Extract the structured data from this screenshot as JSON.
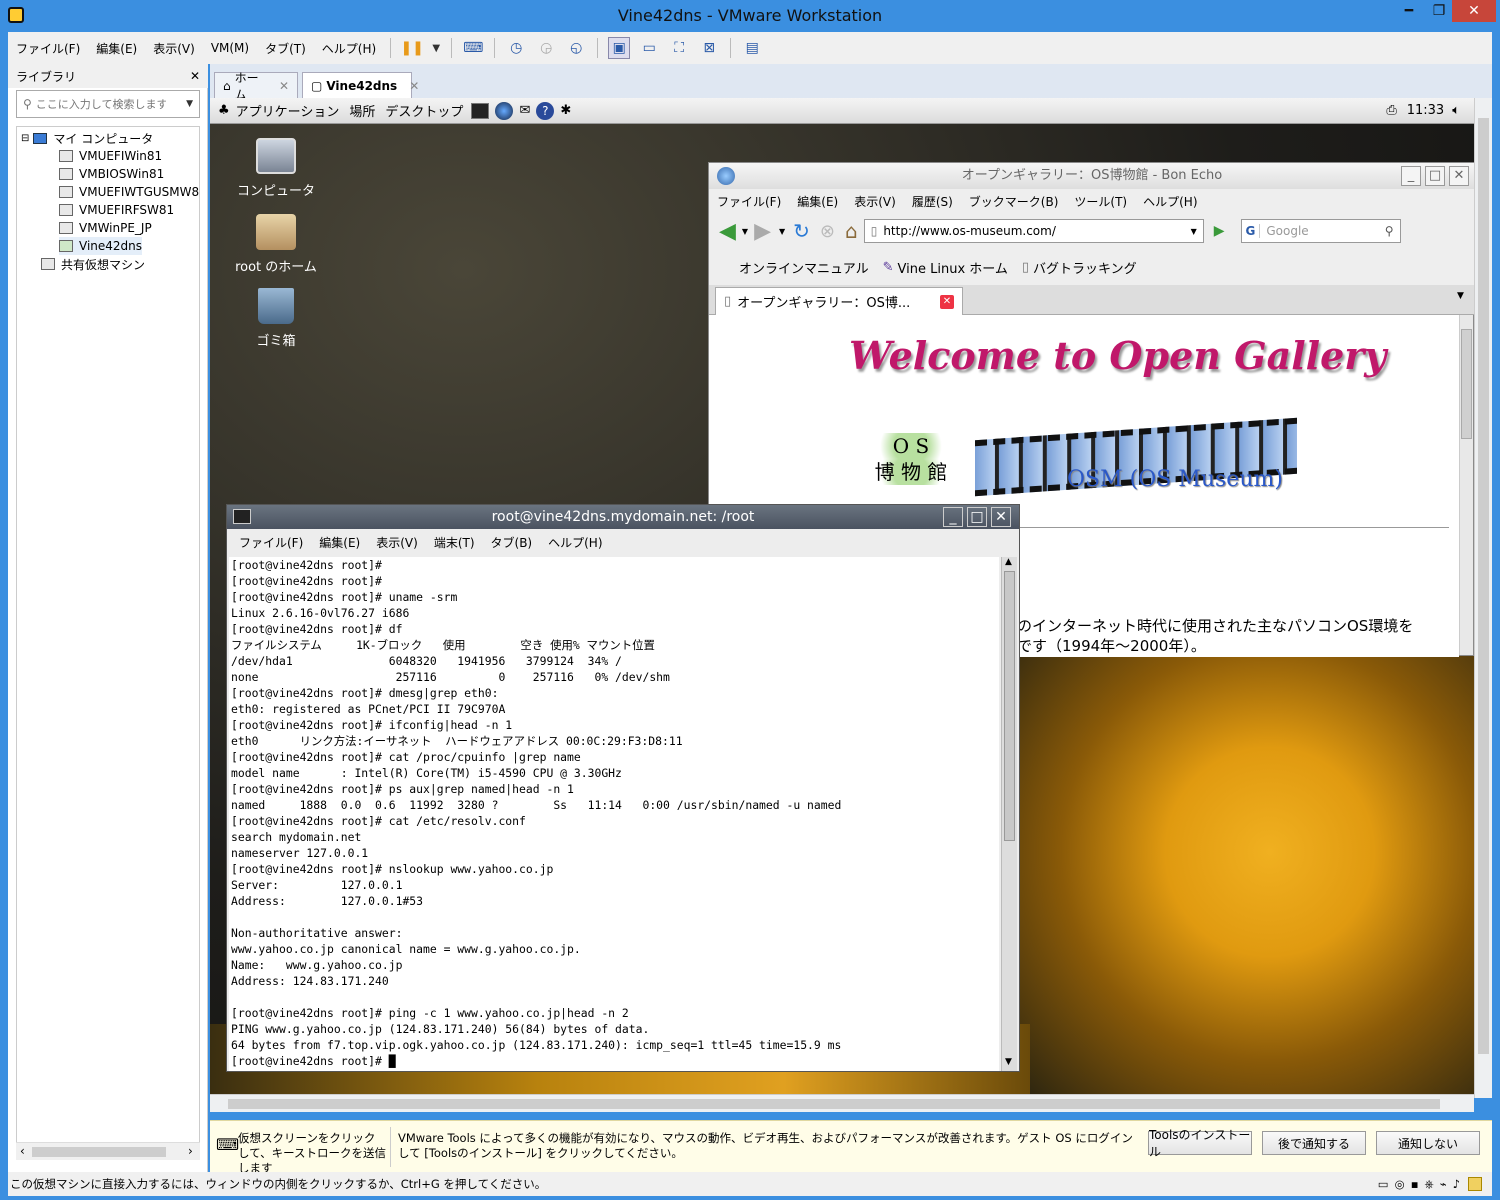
{
  "window": {
    "title": "Vine42dns - VMware Workstation"
  },
  "menubar": {
    "items": [
      "ファイル(F)",
      "編集(E)",
      "表示(V)",
      "VM(M)",
      "タブ(T)",
      "ヘルプ(H)"
    ]
  },
  "library": {
    "title": "ライブラリ",
    "search_placeholder": "ここに入力して検索します",
    "root": "マイ コンピュータ",
    "vms": [
      "VMUEFIWin81",
      "VMBIOSWin81",
      "VMUEFIWTGUSMW8",
      "VMUEFIRFSW81",
      "VMWinPE_JP",
      "Vine42dns"
    ],
    "shared": "共有仮想マシン"
  },
  "tabs": [
    {
      "label": "ホーム"
    },
    {
      "label": "Vine42dns"
    }
  ],
  "guest": {
    "panel": {
      "apps": "アプリケーション",
      "places": "場所",
      "desktop": "デスクトップ",
      "clock": "11:33"
    },
    "desktop_icons": [
      "コンピュータ",
      "root のホーム",
      "ゴミ箱"
    ]
  },
  "firefox": {
    "title": "オープンギャラリー：OS博物館 - Bon Echo",
    "menu": [
      "ファイル(F)",
      "編集(E)",
      "表示(V)",
      "履歴(S)",
      "ブックマーク(B)",
      "ツール(T)",
      "ヘルプ(H)"
    ],
    "url": "http://www.os-museum.com/",
    "search_placeholder": "Google",
    "bookmarks": [
      "オンラインマニュアル",
      "Vine Linux ホーム",
      "バグトラッキング"
    ],
    "tab": "オープンギャラリー：OS博...",
    "welcome": "Welcome to Open Gallery",
    "logo_top": "O S",
    "logo_bottom": "博 物 館",
    "osm": "OSM (OS Museum)",
    "body_line1": "のインターネット時代に使用された主なパソコンOS環境を",
    "body_line2": "です（1994年～2000年）。"
  },
  "terminal": {
    "title": "root@vine42dns.mydomain.net: /root",
    "menu": [
      "ファイル(F)",
      "編集(E)",
      "表示(V)",
      "端末(T)",
      "タブ(B)",
      "ヘルプ(H)"
    ],
    "lines": "[root@vine42dns root]#\n[root@vine42dns root]#\n[root@vine42dns root]# uname -srm\nLinux 2.6.16-0vl76.27 i686\n[root@vine42dns root]# df\nファイルシステム     1K-ブロック   使用        空き 使用% マウント位置\n/dev/hda1              6048320   1941956   3799124  34% /\nnone                    257116         0    257116   0% /dev/shm\n[root@vine42dns root]# dmesg|grep eth0:\neth0: registered as PCnet/PCI II 79C970A\n[root@vine42dns root]# ifconfig|head -n 1\neth0      リンク方法:イーサネット  ハードウェアアドレス 00:0C:29:F3:D8:11\n[root@vine42dns root]# cat /proc/cpuinfo |grep name\nmodel name      : Intel(R) Core(TM) i5-4590 CPU @ 3.30GHz\n[root@vine42dns root]# ps aux|grep named|head -n 1\nnamed     1888  0.0  0.6  11992  3280 ?        Ss   11:14   0:00 /usr/sbin/named -u named\n[root@vine42dns root]# cat /etc/resolv.conf\nsearch mydomain.net\nnameserver 127.0.0.1\n[root@vine42dns root]# nslookup www.yahoo.co.jp\nServer:         127.0.0.1\nAddress:        127.0.0.1#53\n\nNon-authoritative answer:\nwww.yahoo.co.jp canonical name = www.g.yahoo.co.jp.\nName:   www.g.yahoo.co.jp\nAddress: 124.83.171.240\n\n[root@vine42dns root]# ping -c 1 www.yahoo.co.jp|head -n 2\nPING www.g.yahoo.co.jp (124.83.171.240) 56(84) bytes of data.\n64 bytes from f7.top.vip.ogk.yahoo.co.jp (124.83.171.240): icmp_seq=1 ttl=45 time=15.9 ms\n[root@vine42dns root]# █"
  },
  "notify": {
    "left": "仮想スクリーンをクリックして、キーストロークを送信します",
    "message": "VMware Tools によって多くの機能が有効になり、マウスの動作、ビデオ再生、およびパフォーマンスが改善されます。ゲスト OS にログインして [Toolsのインストール] をクリックしてください。",
    "install": "Toolsのインストール",
    "later": "後で通知する",
    "never": "通知しない"
  },
  "status": {
    "text": "この仮想マシンに直接入力するには、ウィンドウの内側をクリックするか、Ctrl+G を押してください。"
  }
}
